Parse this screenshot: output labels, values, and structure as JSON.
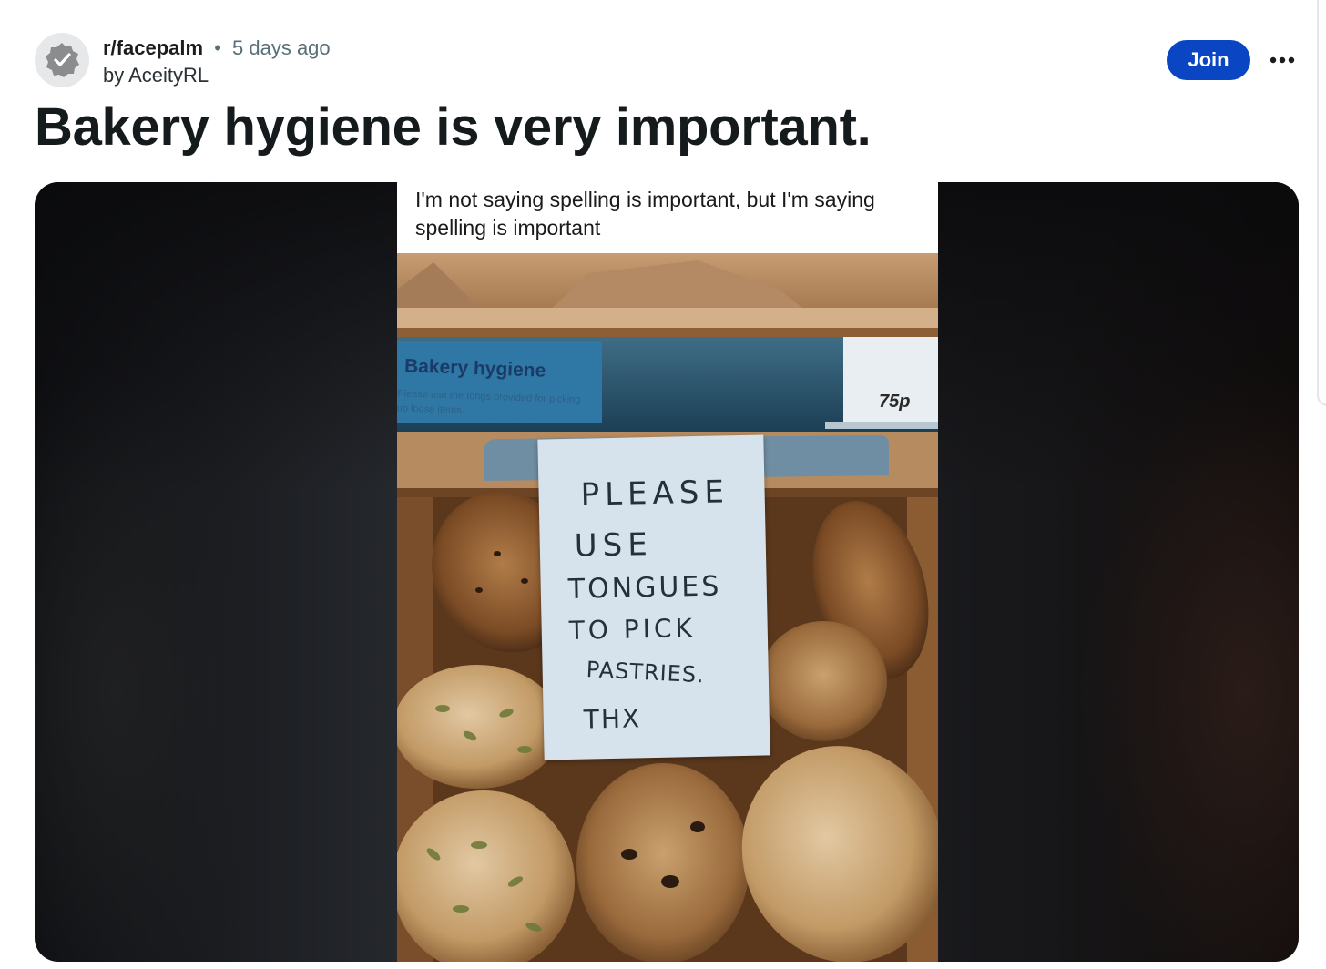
{
  "post": {
    "subreddit": "r/facepalm",
    "separator": "•",
    "time_ago": "5 days ago",
    "byline": "by AceityRL",
    "join_label": "Join",
    "title": "Bakery hygiene is very important."
  },
  "icons": {
    "avatar": "verified-badge-icon",
    "more": "more-options-icon"
  },
  "colors": {
    "join_button": "#0a45c4",
    "meta_gray": "#576f76",
    "title": "#151a1c"
  },
  "media": {
    "caption": "I'm not saying spelling is important, but I'm saying spelling is important",
    "shelf_sign_title": "Bakery hygiene",
    "shelf_sign_text": "Please use the tongs provided for picking up loose items.",
    "price": "75p",
    "note_lines": [
      "PLEASE",
      "USE",
      "TONGUES",
      "TO PICK",
      "PASTRIES.",
      "THX"
    ]
  }
}
